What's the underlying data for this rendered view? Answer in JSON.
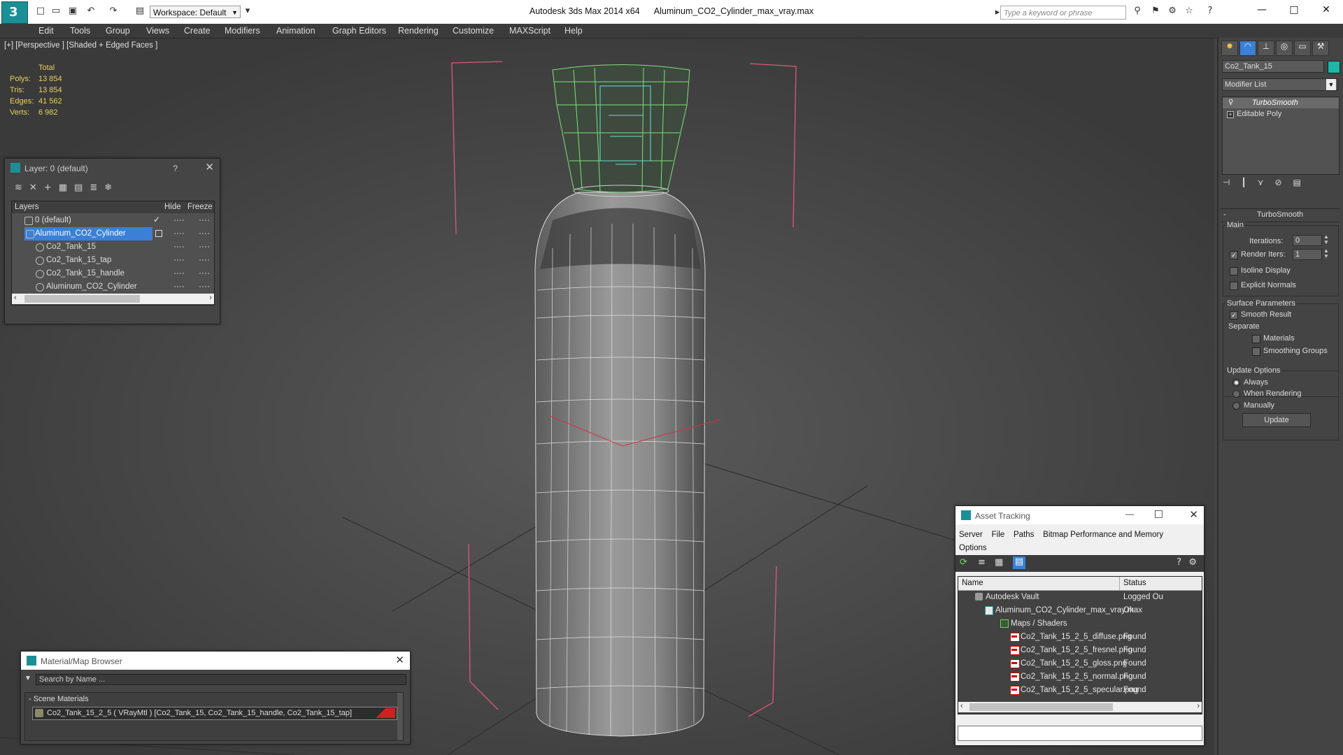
{
  "titlebar": {
    "app_title": "Autodesk 3ds Max  2014 x64",
    "file_name": "Aluminum_CO2_Cylinder_max_vray.max",
    "workspace": "Workspace: Default",
    "search_placeholder": "Type a keyword or phrase"
  },
  "menu": [
    "Edit",
    "Tools",
    "Group",
    "Views",
    "Create",
    "Modifiers",
    "Animation",
    "Graph Editors",
    "Rendering",
    "Customize",
    "MAXScript",
    "Help"
  ],
  "viewport": {
    "label": "[+] [Perspective ] [Shaded + Edged Faces ]",
    "stats": {
      "header": "Total",
      "polys_label": "Polys:",
      "polys": "13 854",
      "tris_label": "Tris:",
      "tris": "13 854",
      "edges_label": "Edges:",
      "edges": "41 562",
      "verts_label": "Verts:",
      "verts": "6 982"
    }
  },
  "layer_window": {
    "title": "Layer: 0 (default)",
    "help": "?",
    "columns": [
      "Layers",
      "Hide",
      "Freeze"
    ],
    "rows": [
      {
        "name": "0 (default)"
      },
      {
        "name": "Aluminum_CO2_Cylinder"
      },
      {
        "name": "Co2_Tank_15"
      },
      {
        "name": "Co2_Tank_15_tap"
      },
      {
        "name": "Co2_Tank_15_handle"
      },
      {
        "name": "Aluminum_CO2_Cylinder"
      }
    ]
  },
  "material_browser": {
    "title": "Material/Map Browser",
    "search_placeholder": "Search by Name ...",
    "section": "- Scene Materials",
    "material": "Co2_Tank_15_2_5  ( VRayMtl )  [Co2_Tank_15, Co2_Tank_15_handle, Co2_Tank_15_tap]"
  },
  "asset_tracking": {
    "title": "Asset Tracking",
    "menu": [
      "Server",
      "File",
      "Paths",
      "Bitmap Performance and Memory",
      "Options"
    ],
    "columns": [
      "Name",
      "Status"
    ],
    "rows": [
      {
        "name": "Autodesk Vault",
        "status": "Logged Ou"
      },
      {
        "name": "Aluminum_CO2_Cylinder_max_vray.max",
        "status": "Ok"
      },
      {
        "name": "Maps / Shaders",
        "status": ""
      },
      {
        "name": "Co2_Tank_15_2_5_diffuse.png",
        "status": "Found"
      },
      {
        "name": "Co2_Tank_15_2_5_fresnel.png",
        "status": "Found"
      },
      {
        "name": "Co2_Tank_15_2_5_gloss.png",
        "status": "Found"
      },
      {
        "name": "Co2_Tank_15_2_5_normal.png",
        "status": "Found"
      },
      {
        "name": "Co2_Tank_15_2_5_specular.png",
        "status": "Found"
      }
    ]
  },
  "command_panel": {
    "object_name": "Co2_Tank_15",
    "object_color": "#1fb5a8",
    "modifier_list": "Modifier List",
    "stack": [
      "TurboSmooth",
      "Editable Poly"
    ],
    "rollout_title": "TurboSmooth",
    "main_label": "Main",
    "iterations_label": "Iterations:",
    "iterations": "0",
    "render_iters_label": "Render Iters:",
    "render_iters": "1",
    "isoline": "Isoline Display",
    "explicit_normals": "Explicit Normals",
    "surface_params": "Surface Parameters",
    "smooth_result": "Smooth Result",
    "separate": "Separate",
    "materials": "Materials",
    "smoothing_groups": "Smoothing Groups",
    "update_options": "Update Options",
    "always": "Always",
    "when_rendering": "When Rendering",
    "manually": "Manually",
    "update_button": "Update"
  }
}
